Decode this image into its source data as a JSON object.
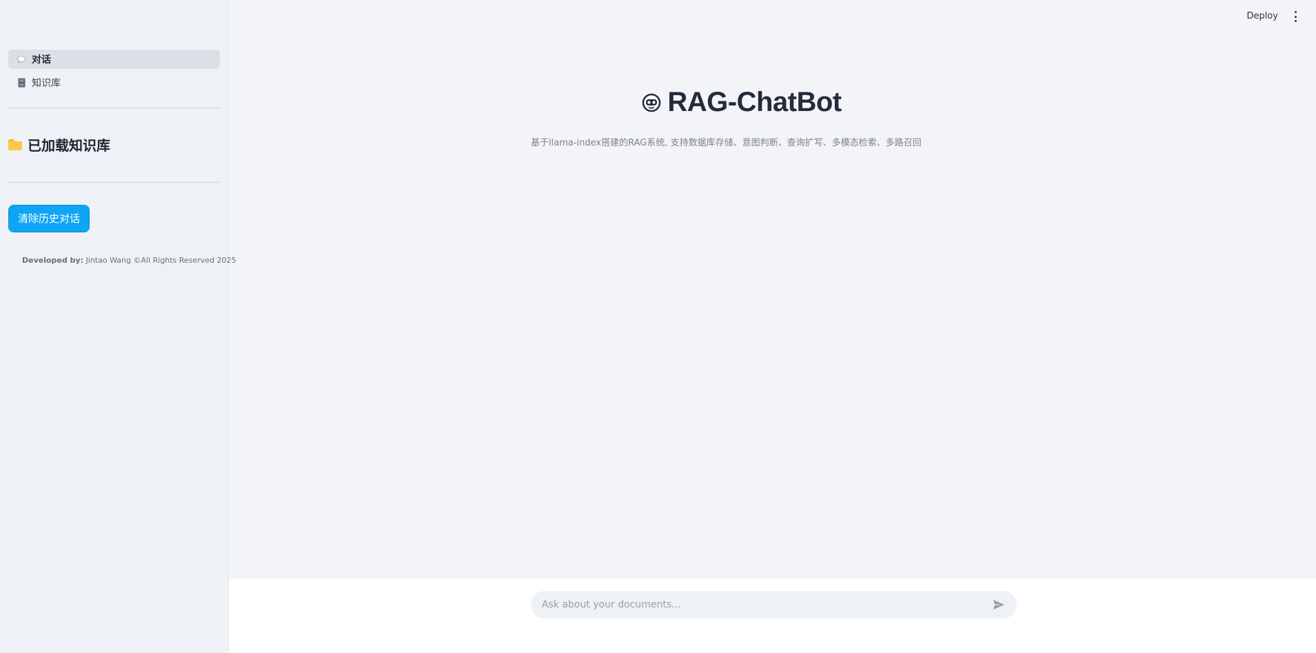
{
  "sidebar": {
    "nav": [
      {
        "label": "对话",
        "icon": "speech-bubble-icon",
        "active": true
      },
      {
        "label": "知识库",
        "icon": "file-cabinet-icon",
        "active": false
      }
    ],
    "kb_heading": "已加载知识库",
    "kb_heading_icon": "folder-icon",
    "clear_button": "清除历史对话",
    "credit_prefix": "Developed by:",
    "credit_text": "Jintao Wang ©All Rights Reserved 2025"
  },
  "header": {
    "deploy_label": "Deploy",
    "menu_icon": "kebab-menu-icon"
  },
  "main": {
    "title": "RAG-ChatBot",
    "title_icon": "robot-face-icon",
    "subtitle": "基于llama-index搭建的RAG系统, 支持数据库存储、意图判断、查询扩写、多模态检索、多路召回"
  },
  "chat": {
    "placeholder": "Ask about your documents...",
    "send_icon": "send-icon"
  },
  "colors": {
    "primary_button": "#0ea5f5",
    "sidebar_bg": "#eef1f5",
    "main_bg": "#f3f4f8"
  }
}
